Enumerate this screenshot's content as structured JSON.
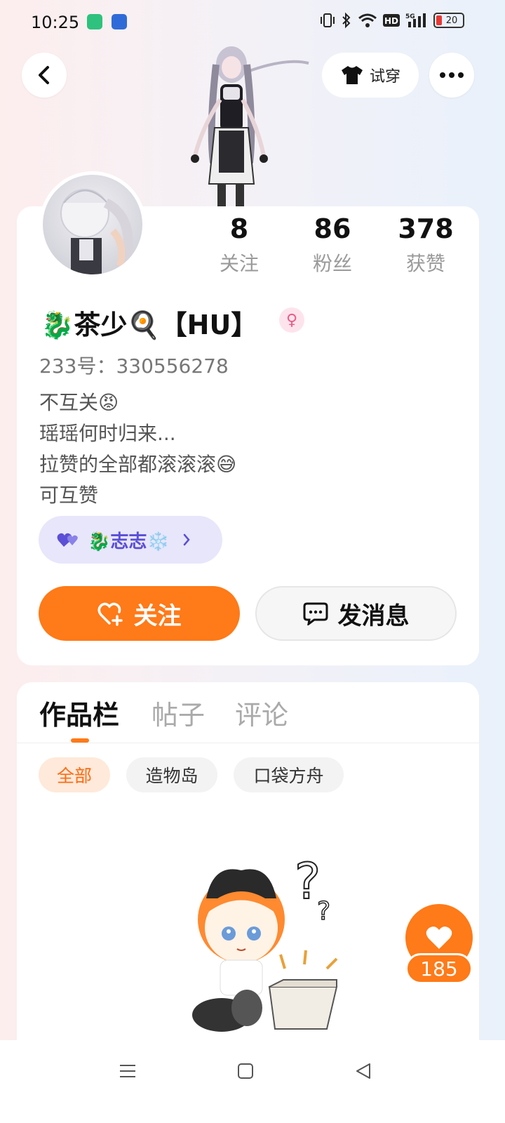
{
  "status_bar": {
    "time": "10:25",
    "battery_level": "20",
    "network": "5G",
    "icons": [
      "battery-saver-icon",
      "app-badge-icon",
      "vibrate-icon",
      "bluetooth-icon",
      "wifi-icon",
      "hd-icon",
      "signal-icon",
      "battery-icon"
    ]
  },
  "header": {
    "back_icon": "chevron-left-icon",
    "tryon_label": "试穿",
    "tryon_icon": "tshirt-icon",
    "more_icon": "more-dots-icon"
  },
  "profile": {
    "stats": [
      {
        "value": "8",
        "label": "关注"
      },
      {
        "value": "86",
        "label": "粉丝"
      },
      {
        "value": "378",
        "label": "获赞"
      }
    ],
    "nickname_prefix": "🐉茶少🍳",
    "nickname_tag": "【HU】",
    "gender_symbol": "♀",
    "uid": "233号：330556278",
    "bio_lines": [
      "不互关😡",
      "瑶瑶何时归来...",
      "拉赞的全部都滚滚滚😅",
      "可互赞"
    ],
    "group_label": "🐉志志❄️",
    "follow_label": "关注",
    "message_label": "发消息"
  },
  "works": {
    "tabs": [
      "作品栏",
      "帖子",
      "评论"
    ],
    "filters": [
      "全部",
      "造物岛",
      "口袋方舟"
    ],
    "like_count": "185"
  },
  "colors": {
    "accent": "#ff7a18",
    "group_pill_bg": "#e8e6fb",
    "group_pill_text": "#5a4fd6"
  }
}
